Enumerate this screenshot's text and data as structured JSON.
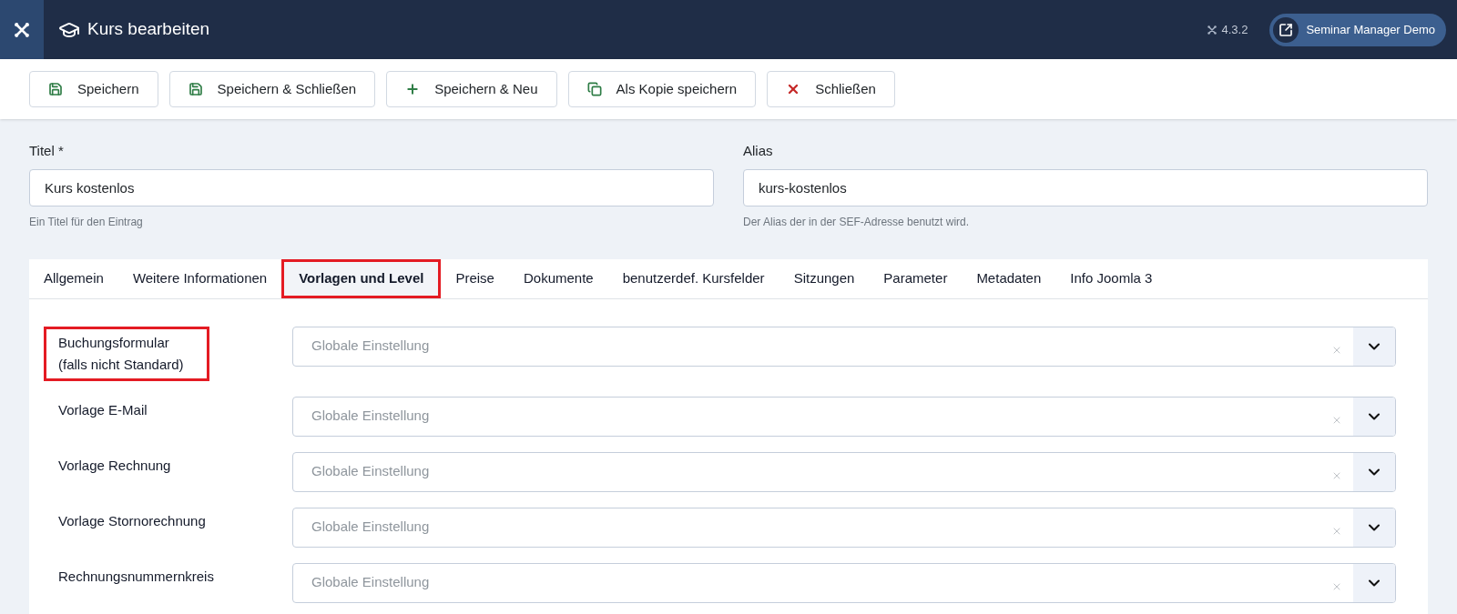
{
  "header": {
    "title": "Kurs bearbeiten",
    "version": "4.3.2",
    "user_button": "Seminar Manager Demo"
  },
  "toolbar": [
    {
      "label": "Speichern",
      "kind": "save"
    },
    {
      "label": "Speichern & Schließen",
      "kind": "save"
    },
    {
      "label": "Speichern & Neu",
      "kind": "new"
    },
    {
      "label": "Als Kopie speichern",
      "kind": "copy"
    },
    {
      "label": "Schließen",
      "kind": "close"
    }
  ],
  "fields": [
    {
      "label": "Titel *",
      "value": "Kurs kostenlos",
      "hint": "Ein Titel für den Eintrag"
    },
    {
      "label": "Alias",
      "value": "kurs-kostenlos",
      "hint": "Der Alias der in der SEF-Adresse benutzt wird."
    }
  ],
  "tabs": [
    {
      "label": "Allgemein",
      "selected": false,
      "highlighted": false
    },
    {
      "label": "Weitere Informationen",
      "selected": false,
      "highlighted": false
    },
    {
      "label": "Vorlagen und Level",
      "selected": true,
      "highlighted": true
    },
    {
      "label": "Preise",
      "selected": false,
      "highlighted": false
    },
    {
      "label": "Dokumente",
      "selected": false,
      "highlighted": false
    },
    {
      "label": "benutzerdef. Kursfelder",
      "selected": false,
      "highlighted": false
    },
    {
      "label": "Sitzungen",
      "selected": false,
      "highlighted": false
    },
    {
      "label": "Parameter",
      "selected": false,
      "highlighted": false
    },
    {
      "label": "Metadaten",
      "selected": false,
      "highlighted": false
    },
    {
      "label": "Info Joomla 3",
      "selected": false,
      "highlighted": false
    }
  ],
  "settings": [
    {
      "label": "Buchungsformular (falls nicht Standard)",
      "placeholder": "Globale Einstellung",
      "highlighted": true
    },
    {
      "label": "Vorlage E-Mail",
      "placeholder": "Globale Einstellung",
      "highlighted": false
    },
    {
      "label": "Vorlage Rechnung",
      "placeholder": "Globale Einstellung",
      "highlighted": false
    },
    {
      "label": "Vorlage Stornorechnung",
      "placeholder": "Globale Einstellung",
      "highlighted": false
    },
    {
      "label": "Rechnungsnummernkreis",
      "placeholder": "Globale Einstellung",
      "highlighted": false
    }
  ]
}
